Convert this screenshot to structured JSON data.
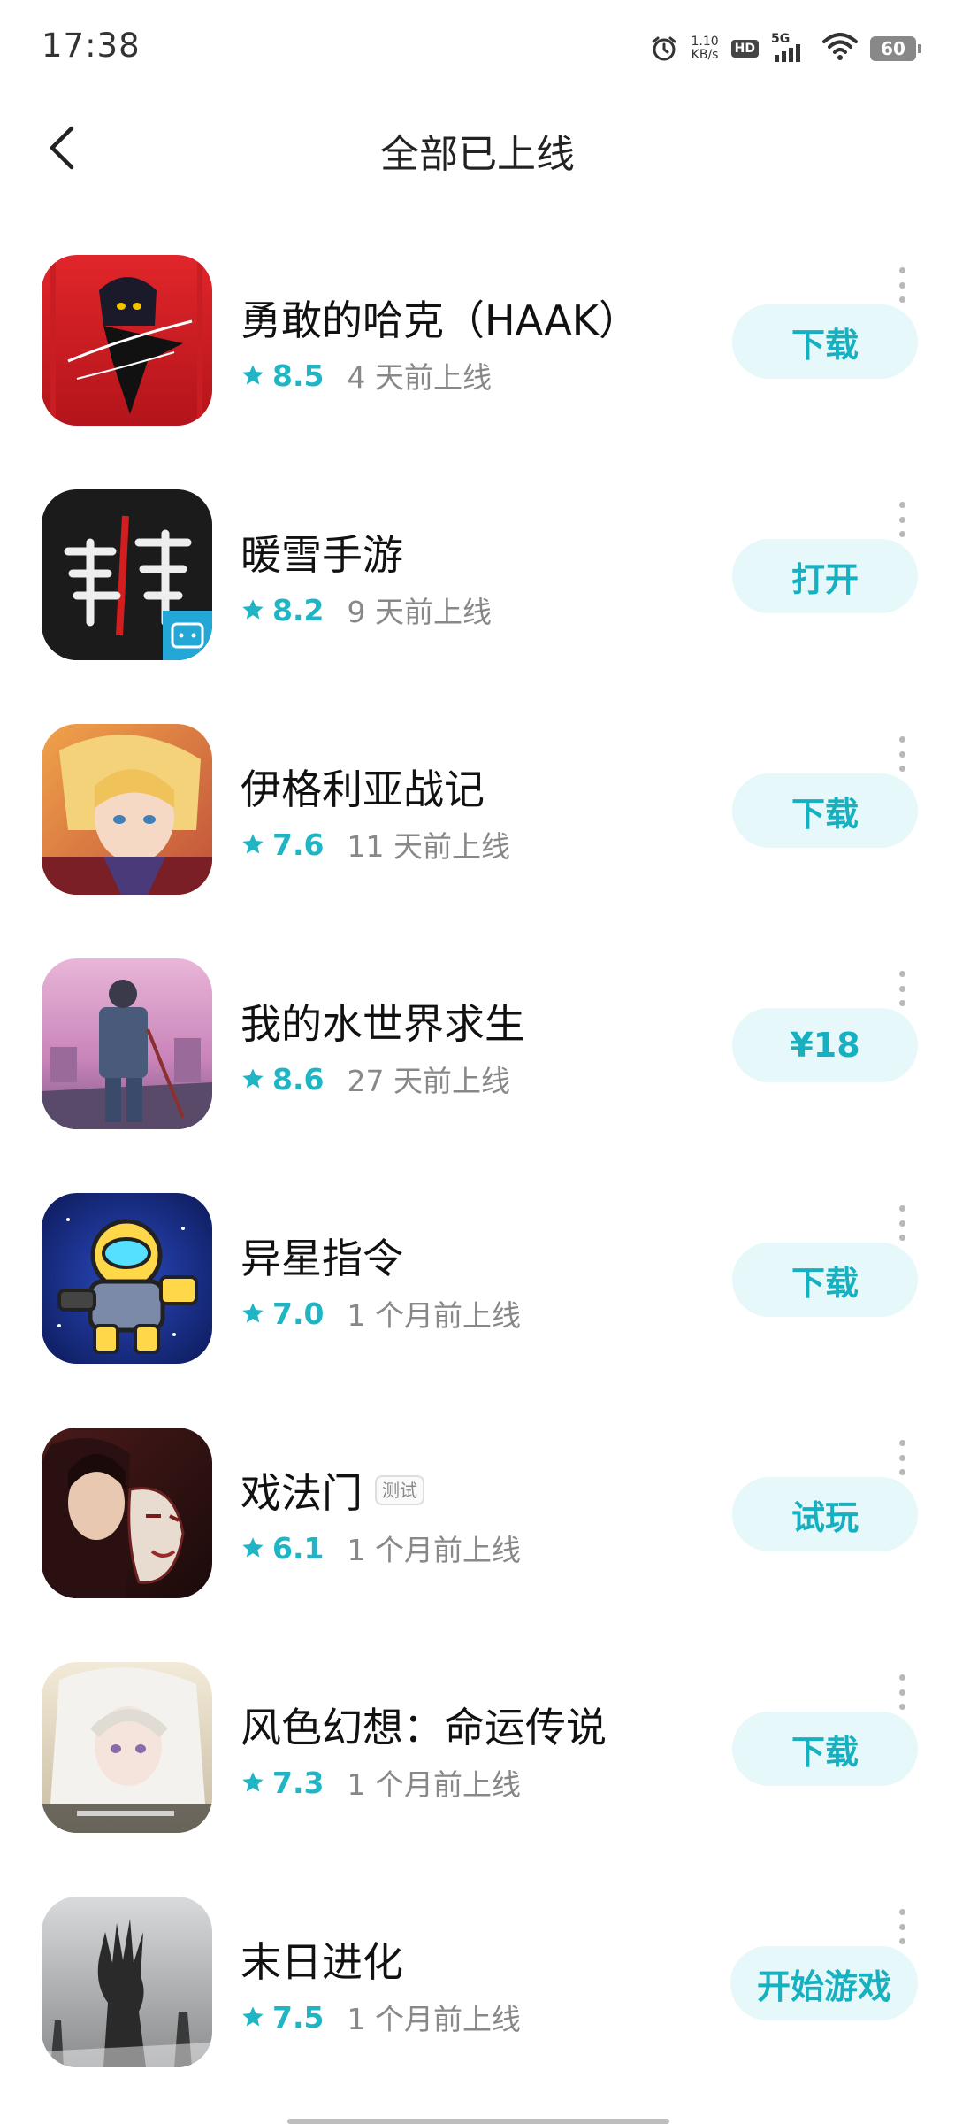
{
  "status_bar": {
    "time": "17:38",
    "net_speed_value": "1.10",
    "net_speed_unit": "KB/s",
    "hd_label": "HD",
    "network_label": "5G",
    "battery": "60"
  },
  "header": {
    "title": "全部已上线"
  },
  "colors": {
    "accent": "#1fb5c4",
    "button_bg": "#e6f8f9",
    "meta_gray": "#888888"
  },
  "games": [
    {
      "name": "勇敢的哈克（HAAK）",
      "rating": "8.5",
      "released": "4 天前上线",
      "action": "下载",
      "badge": ""
    },
    {
      "name": "暖雪手游",
      "rating": "8.2",
      "released": "9 天前上线",
      "action": "打开",
      "badge": ""
    },
    {
      "name": "伊格利亚战记",
      "rating": "7.6",
      "released": "11 天前上线",
      "action": "下载",
      "badge": ""
    },
    {
      "name": "我的水世界求生",
      "rating": "8.6",
      "released": "27 天前上线",
      "action": "¥18",
      "badge": ""
    },
    {
      "name": "异星指令",
      "rating": "7.0",
      "released": "1 个月前上线",
      "action": "下载",
      "badge": ""
    },
    {
      "name": "戏法门",
      "rating": "6.1",
      "released": "1 个月前上线",
      "action": "试玩",
      "badge": "测试"
    },
    {
      "name": "风色幻想：命运传说",
      "rating": "7.3",
      "released": "1 个月前上线",
      "action": "下载",
      "badge": ""
    },
    {
      "name": "末日进化",
      "rating": "7.5",
      "released": "1 个月前上线",
      "action": "开始游戏",
      "badge": ""
    }
  ]
}
